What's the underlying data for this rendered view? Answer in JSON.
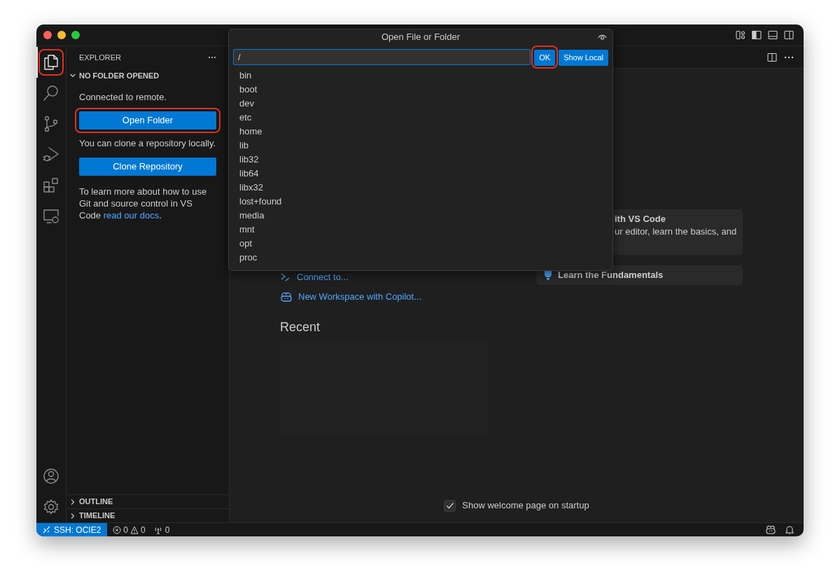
{
  "activity_bar": {
    "items": [
      {
        "kind": "explorer",
        "selected": true,
        "highlighted": true
      },
      {
        "kind": "search",
        "selected": false,
        "highlighted": false
      },
      {
        "kind": "source-control",
        "selected": false,
        "highlighted": false
      },
      {
        "kind": "debug",
        "selected": false,
        "highlighted": false
      },
      {
        "kind": "extensions",
        "selected": false,
        "highlighted": false
      },
      {
        "kind": "remote-explorer",
        "selected": false,
        "highlighted": false
      }
    ],
    "bottom_items": [
      {
        "kind": "accounts"
      },
      {
        "kind": "settings"
      }
    ]
  },
  "sidebar": {
    "title": "EXPLORER",
    "section": {
      "title": "NO FOLDER OPENED",
      "expanded": true
    },
    "content": [
      {
        "kind": "text",
        "text": "Connected to remote."
      },
      {
        "kind": "button",
        "label": "Open Folder",
        "highlighted": true
      },
      {
        "kind": "text",
        "text": "You can clone a repository locally."
      },
      {
        "kind": "button",
        "label": "Clone Repository",
        "highlighted": false
      },
      {
        "kind": "paragraph",
        "text": "To learn more about how to use Git and source control in VS Code",
        "link": "read our docs",
        "after": "."
      }
    ],
    "bottom_sections": [
      {
        "title": "OUTLINE",
        "expanded": false
      },
      {
        "title": "TIMELINE",
        "expanded": false
      }
    ]
  },
  "welcome": {
    "start_links": [
      {
        "kind": "remote",
        "label": "Connect to..."
      },
      {
        "kind": "copilot",
        "label": "New Workspace with Copilot..."
      }
    ],
    "recent": {
      "title": "Recent"
    },
    "walkthroughs": [
      {
        "title": "ith VS Code",
        "description": "ur editor, learn the basics, and"
      },
      {
        "title": "Learn the Fundamentals",
        "kind": "bulb"
      }
    ],
    "show_on_startup": {
      "label": "Show welcome page on startup",
      "checked": true
    }
  },
  "dialog": {
    "title": "Open File or Folder",
    "value": "/",
    "buttons": [
      {
        "label": "OK",
        "highlighted": true
      },
      {
        "label": "Show Local",
        "highlighted": false
      }
    ],
    "items": [
      "bin",
      "boot",
      "dev",
      "etc",
      "home",
      "lib",
      "lib32",
      "lib64",
      "libx32",
      "lost+found",
      "media",
      "mnt",
      "opt",
      "proc"
    ]
  },
  "status_bar": {
    "remote": "SSH: OCIE2",
    "errors": "0",
    "warnings": "0",
    "ports": "0"
  }
}
